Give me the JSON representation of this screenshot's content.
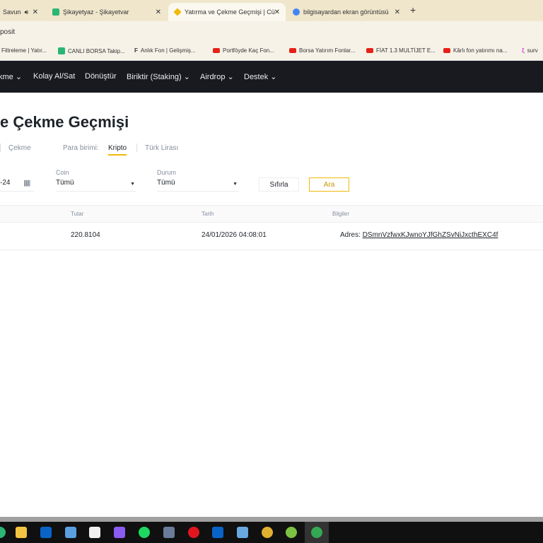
{
  "browser": {
    "tabs": [
      {
        "label": "Savun",
        "active": false
      },
      {
        "label": "Şikayetyaz - Şikayetvar",
        "active": false
      },
      {
        "label": "Yatırma ve Çekme Geçmişi | Cü",
        "active": true
      },
      {
        "label": "bilgisayardan ekran görüntüsü",
        "active": false
      }
    ],
    "new_tab": "+",
    "close": "✕",
    "address": "posit",
    "bookmarks": [
      "Filtreleme | Yatır...",
      "CANLI BORSA Takip...",
      "Anlık Fon | Gelişmiş...",
      "Portföyde Kaç Fon...",
      "Borsa Yatırım Fonlar...",
      "FİAT 1.3 MULTİJET E...",
      "Kârlı fon yatırımı na...",
      "surv"
    ]
  },
  "nav": {
    "items": [
      "kme",
      "Kolay Al/Sat",
      "Dönüştür",
      "Biriktir (Staking)",
      "Airdrop",
      "Destek"
    ]
  },
  "page": {
    "title": "e Çekme Geçmişi",
    "type_tab": "Çekme",
    "currency_label": "Para birimi:",
    "currency_tabs": [
      "Kripto",
      "Türk Lirası"
    ],
    "date_value": "-24",
    "coin_label": "Coin",
    "coin_value": "Tümü",
    "status_label": "Durum",
    "status_value": "Tümü",
    "reset": "Sıfırla",
    "search": "Ara",
    "columns": [
      "Tutar",
      "Tarih",
      "Bilgiler"
    ],
    "rows": [
      {
        "amount": "220.8104",
        "date": "24/01/2026 04:08:01",
        "info_label": "Adres:",
        "address": "DSmnVzfwxKJwnoYJfGhZSvNiJxcthEXC4f"
      }
    ]
  },
  "colors": {
    "accent": "#f0b90b",
    "nav_bg": "#181a20"
  }
}
